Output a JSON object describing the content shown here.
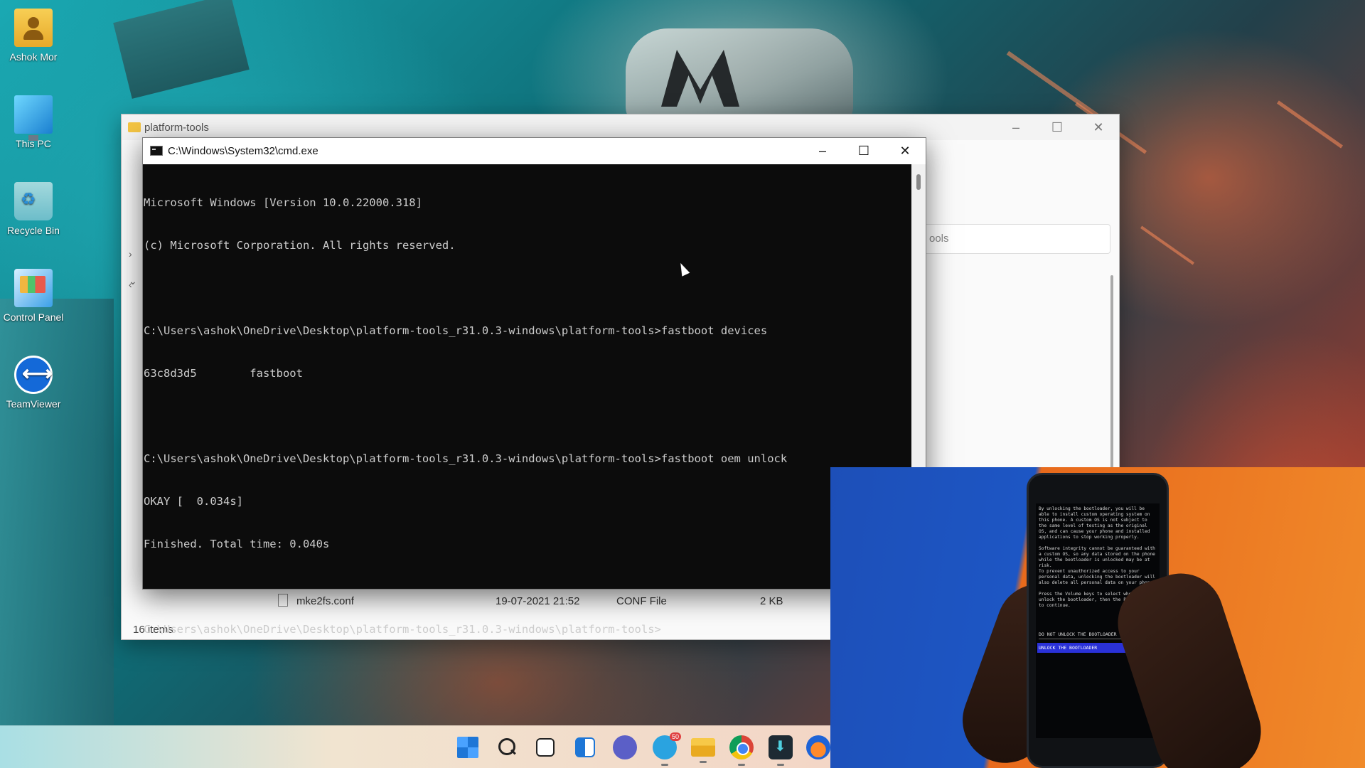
{
  "desktop": {
    "icons": [
      {
        "label": "Ashok Mor",
        "icon": "user-folder-icon"
      },
      {
        "label": "This PC",
        "icon": "monitor-icon"
      },
      {
        "label": "Recycle Bin",
        "icon": "recycle-bin-icon"
      },
      {
        "label": "Control Panel",
        "icon": "control-panel-icon"
      },
      {
        "label": "TeamViewer",
        "icon": "teamviewer-icon"
      }
    ]
  },
  "explorer": {
    "title": "platform-tools",
    "search_partial": "ools",
    "file_row": {
      "name": "mke2fs.conf",
      "modified": "19-07-2021 21:52",
      "type": "CONF File",
      "size": "2 KB"
    },
    "items_count": "16 items",
    "controls": {
      "minimize": "–",
      "maximize": "☐",
      "close": "✕"
    }
  },
  "cmd": {
    "title": "C:\\Windows\\System32\\cmd.exe",
    "controls": {
      "minimize": "–",
      "maximize": "☐",
      "close": "✕"
    },
    "lines": [
      "Microsoft Windows [Version 10.0.22000.318]",
      "(c) Microsoft Corporation. All rights reserved.",
      "",
      "C:\\Users\\ashok\\OneDrive\\Desktop\\platform-tools_r31.0.3-windows\\platform-tools>fastboot devices",
      "63c8d3d5        fastboot",
      "",
      "C:\\Users\\ashok\\OneDrive\\Desktop\\platform-tools_r31.0.3-windows\\platform-tools>fastboot oem unlock",
      "OKAY [  0.034s]",
      "Finished. Total time: 0.040s",
      "",
      "C:\\Users\\ashok\\OneDrive\\Desktop\\platform-tools_r31.0.3-windows\\platform-tools>"
    ]
  },
  "webcam": {
    "phone_text": "By unlocking the bootloader, you will be able to install custom operating system on this phone. A custom OS is not subject to the same level of testing as the original OS, and can cause your phone and installed applications to stop working properly.\n\nSoftware integrity cannot be guaranteed with a custom OS, so any data stored on the phone while the bootloader is unlocked may be at risk.\nTo prevent unauthorized access to your personal data, unlocking the bootloader will also delete all personal data on your phone.\n\nPress the Volume keys to select whether to unlock the bootloader, then the Power Button to continue.",
    "option_1": "DO NOT UNLOCK THE BOOTLOADER",
    "option_2": "UNLOCK THE BOOTLOADER"
  },
  "taskbar": {
    "items": [
      "start-icon",
      "search-icon",
      "task-view-icon",
      "widgets-icon",
      "chat-icon",
      "telegram-icon",
      "file-explorer-icon",
      "chrome-icon",
      "download-app-icon",
      "headphones-icon"
    ],
    "telegram_badge": "50"
  }
}
